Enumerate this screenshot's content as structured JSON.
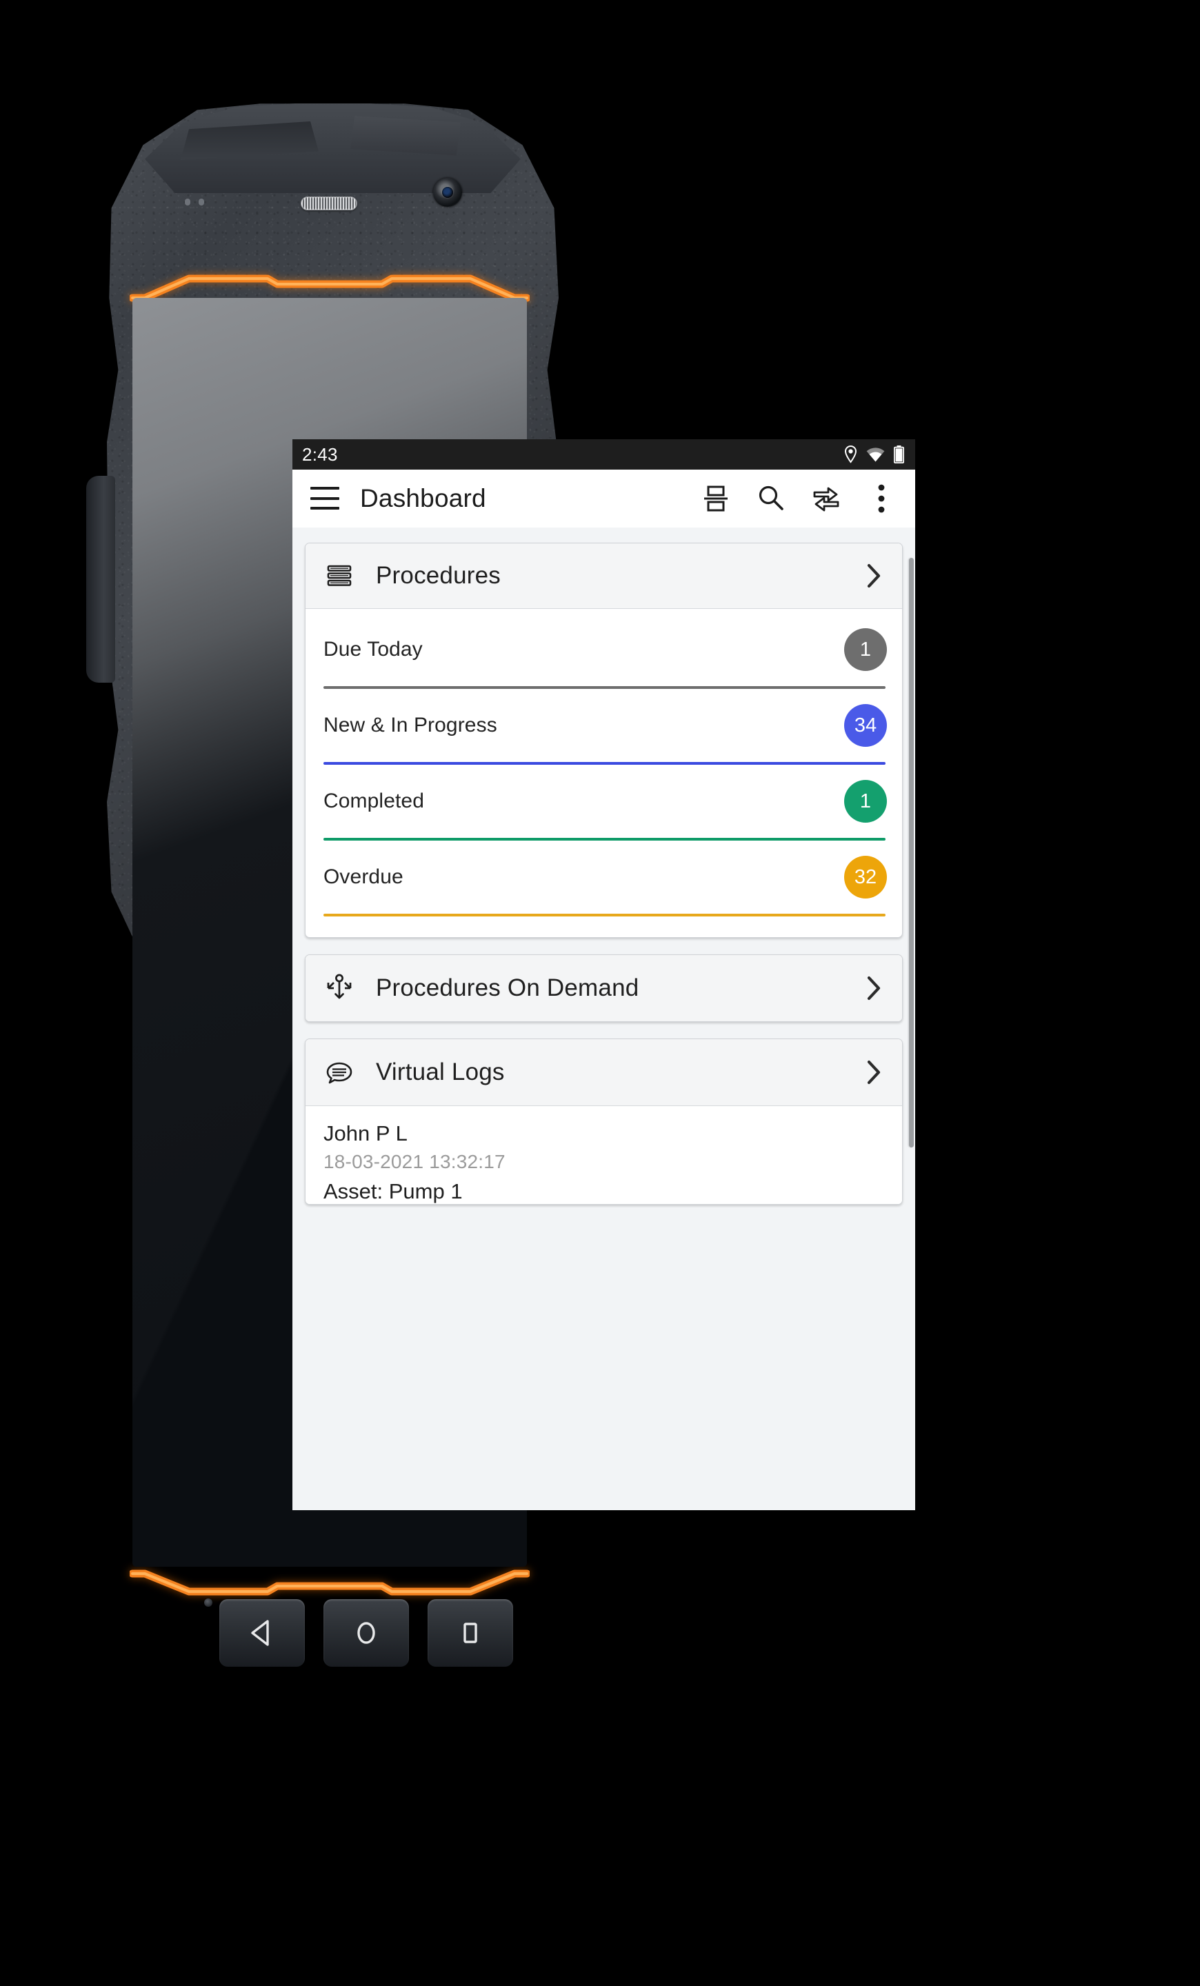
{
  "device": {
    "type": "rugged-android-phone",
    "accent_color": "#f5821f",
    "body_color": "#3a3e44"
  },
  "statusbar": {
    "clock": "2:43",
    "icons": [
      "location-pin-icon",
      "wifi-icon",
      "battery-icon"
    ]
  },
  "appbar": {
    "menu_icon": "hamburger-menu-icon",
    "title": "Dashboard",
    "actions": [
      {
        "name": "split-screen-icon",
        "label": "Split Screen"
      },
      {
        "name": "search-icon",
        "label": "Search"
      },
      {
        "name": "sync-transfer-icon",
        "label": "Sync"
      },
      {
        "name": "overflow-menu-icon",
        "label": "More options"
      }
    ]
  },
  "cards": {
    "procedures": {
      "icon": "stacked-lines-icon",
      "title": "Procedures",
      "chevron": "chevron-right-icon",
      "stats": [
        {
          "label": "Due Today",
          "count": "1",
          "color": "#6e6e6e"
        },
        {
          "label": "New & In Progress",
          "count": "34",
          "color": "#4a5ae8"
        },
        {
          "label": "Completed",
          "count": "1",
          "color": "#14a06e"
        },
        {
          "label": "Overdue",
          "count": "32",
          "color": "#eda50a"
        }
      ]
    },
    "procedures_on_demand": {
      "icon": "anchor-move-icon",
      "title": "Procedures On Demand",
      "chevron": "chevron-right-icon"
    },
    "virtual_logs": {
      "icon": "speech-bubble-lines-icon",
      "title": "Virtual Logs",
      "chevron": "chevron-right-icon",
      "entries": [
        {
          "name": "John P L",
          "timestamp": "18-03-2021 13:32:17",
          "meta": "Asset: Pump 1"
        }
      ]
    }
  },
  "hardware_nav": {
    "buttons": [
      {
        "name": "back-button",
        "glyph": "triangle-left"
      },
      {
        "name": "home-button",
        "glyph": "circle"
      },
      {
        "name": "recents-button",
        "glyph": "square"
      }
    ]
  }
}
